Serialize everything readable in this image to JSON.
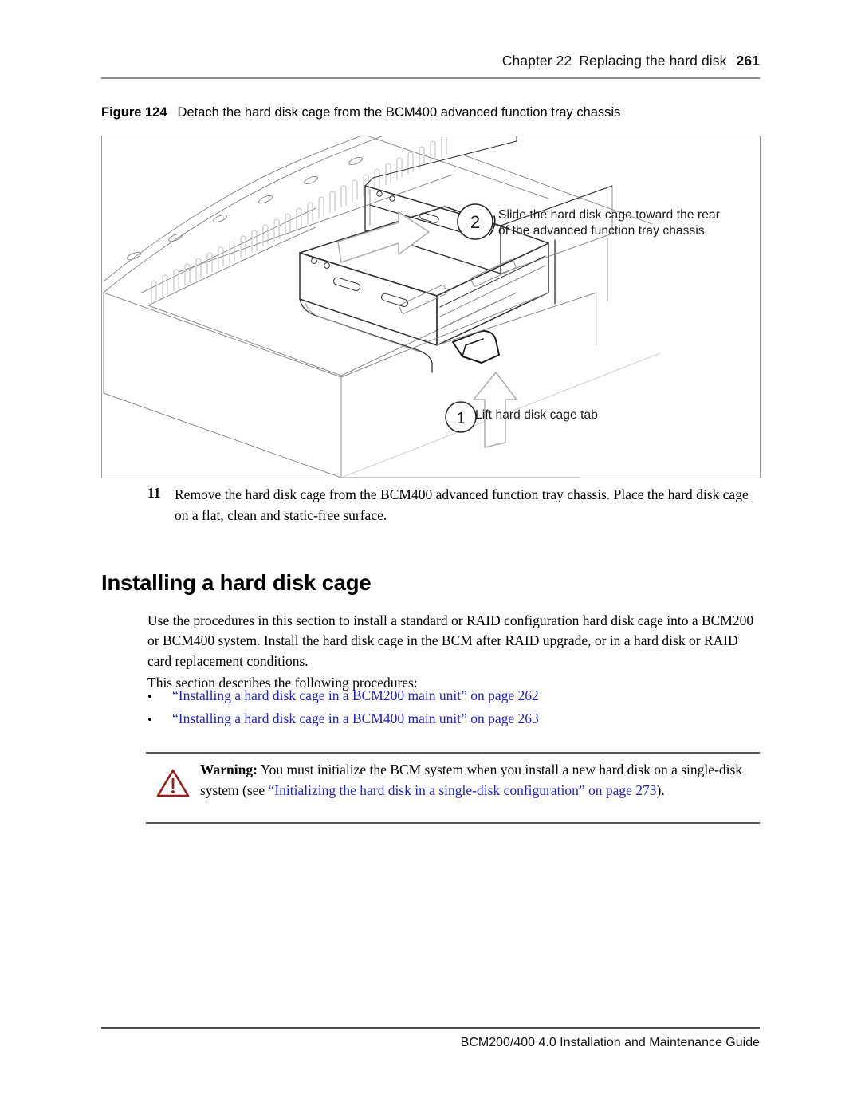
{
  "header": {
    "chapter": "Chapter 22",
    "title": "Replacing the hard disk",
    "page_number": "261"
  },
  "figure": {
    "label": "Figure 124",
    "caption": "Detach the hard disk cage from the BCM400 advanced function tray chassis",
    "illustration_description": "Isometric line drawing of a BCM400 advanced function tray chassis with the hard disk cage being slid out",
    "callouts": [
      {
        "number": "1",
        "line1": "Lift hard disk cage tab",
        "line2": ""
      },
      {
        "number": "2",
        "line1": "Slide the hard disk cage toward the rear",
        "line2": "of the advanced function tray chassis"
      }
    ]
  },
  "step": {
    "number": "11",
    "text": "Remove the hard disk cage from the BCM400 advanced function tray chassis. Place the hard disk cage on a flat, clean and static-free surface."
  },
  "section": {
    "heading": "Installing a hard disk cage",
    "intro": "Use the procedures in this section to install a standard or RAID configuration hard disk cage into a BCM200 or BCM400 system. Install the hard disk cage in the BCM after RAID upgrade, or in a hard disk or RAID card replacement conditions.",
    "describes": "This section describes the following procedures:",
    "bullet_marker": "•",
    "links": [
      "“Installing a hard disk cage in a BCM200 main unit” on page 262",
      "“Installing a hard disk cage in a BCM400 main unit” on page 263"
    ]
  },
  "warning": {
    "icon": "warning-triangle-icon",
    "label": "Warning:",
    "text_before_link": " You must initialize the BCM system when you install a new hard disk on a single-disk system (see ",
    "link_text": "“Initializing the hard disk in a single-disk configuration” on page 273",
    "text_after_link": ")."
  },
  "footer": {
    "text": "BCM200/400 4.0 Installation and Maintenance Guide"
  },
  "colors": {
    "link": "#2222cc",
    "warning_icon": "#9b1b1b",
    "rule_gray": "#8d8d8d",
    "figure_border": "#9a9a9a"
  }
}
